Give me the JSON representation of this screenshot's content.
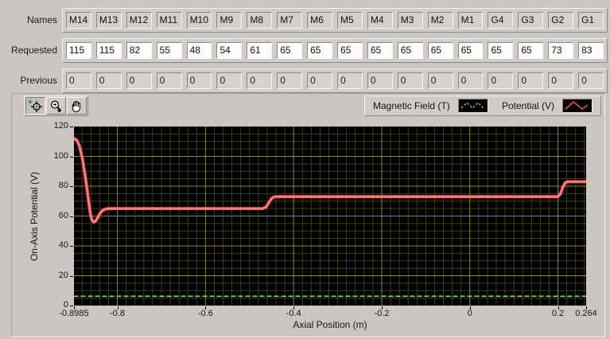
{
  "table": {
    "rows": [
      {
        "label": "Names",
        "type": "names",
        "editable": true,
        "values": [
          "M14",
          "M13",
          "M12",
          "M11",
          "M10",
          "M9",
          "M8",
          "M7",
          "M6",
          "M5",
          "M4",
          "M3",
          "M2",
          "M1",
          "G4",
          "G3",
          "G2",
          "G1"
        ]
      },
      {
        "label": "Requested",
        "type": "requested",
        "editable": true,
        "values": [
          "115",
          "115",
          "82",
          "55",
          "48",
          "54",
          "61",
          "65",
          "65",
          "65",
          "65",
          "65",
          "65",
          "65",
          "65",
          "65",
          "73",
          "83"
        ]
      },
      {
        "label": "Previous",
        "type": "previous",
        "editable": false,
        "values": [
          "0",
          "0",
          "0",
          "0",
          "0",
          "0",
          "0",
          "0",
          "0",
          "0",
          "0",
          "0",
          "0",
          "0",
          "0",
          "0",
          "0",
          "0"
        ]
      }
    ]
  },
  "toolbar": {
    "buttons": [
      "cursor-tool",
      "zoom-tool",
      "pan-tool"
    ]
  },
  "legend": [
    {
      "label": "Magnetic Field (T)",
      "color": "#74c274",
      "style": "dashed"
    },
    {
      "label": "Potential (V)",
      "color": "#f25252",
      "style": "solid"
    }
  ],
  "chart_data": {
    "type": "line",
    "xlabel": "Axial Position (m)",
    "ylabel": "On-Axis Potential (V)",
    "xlim": [
      -0.8985,
      0.264
    ],
    "ylim": [
      0,
      120
    ],
    "x_ticks": [
      -0.8985,
      -0.8,
      -0.6,
      -0.4,
      -0.2,
      0,
      0.2,
      0.264
    ],
    "x_tick_labels": [
      "-0.8985",
      "-0.8",
      "-0.6",
      "-0.4",
      "-0.2",
      "0",
      "0.2",
      "0.264"
    ],
    "y_ticks": [
      0,
      20,
      40,
      60,
      80,
      100,
      120
    ],
    "plot_bg": "#000000",
    "grid": {
      "major_color": "#8a8a28",
      "minor_color": "#3f3f12",
      "x_major_step": 0.2,
      "x_minor_step": 0.02,
      "y_major_step": 20,
      "y_minor_step": 5
    },
    "series": [
      {
        "name": "Potential (V)",
        "color": "#f25252",
        "highlight": "#ff9a9a",
        "style": "solid",
        "width": 4,
        "points": [
          [
            -0.8985,
            112
          ],
          [
            -0.8925,
            111
          ],
          [
            -0.886,
            107
          ],
          [
            -0.879,
            98
          ],
          [
            -0.8725,
            86
          ],
          [
            -0.8665,
            73
          ],
          [
            -0.8615,
            62
          ],
          [
            -0.858,
            57.5
          ],
          [
            -0.854,
            56
          ],
          [
            -0.85,
            56.5
          ],
          [
            -0.8455,
            58.5
          ],
          [
            -0.84,
            61.5
          ],
          [
            -0.8335,
            63.8
          ],
          [
            -0.826,
            64.8
          ],
          [
            -0.818,
            65
          ],
          [
            -0.47,
            65
          ],
          [
            -0.4625,
            66
          ],
          [
            -0.456,
            69
          ],
          [
            -0.45,
            71.8
          ],
          [
            -0.4445,
            72.8
          ],
          [
            -0.4395,
            73
          ],
          [
            0.1995,
            73
          ],
          [
            0.2055,
            74.8
          ],
          [
            0.2115,
            79.5
          ],
          [
            0.2165,
            82.4
          ],
          [
            0.2215,
            83
          ],
          [
            0.264,
            83
          ]
        ]
      },
      {
        "name": "Magnetic Field (T)",
        "color": "#8fd48f",
        "highlight": "#8fd48f",
        "style": "dashed",
        "width": 1.5,
        "points": [
          [
            -0.8985,
            6.3
          ],
          [
            0.264,
            6.3
          ]
        ]
      }
    ]
  }
}
